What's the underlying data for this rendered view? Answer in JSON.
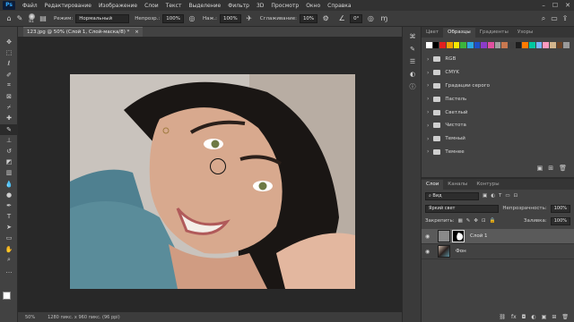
{
  "app": {
    "logo": "Ps"
  },
  "menubar": {
    "items": [
      "Файл",
      "Редактирование",
      "Изображение",
      "Слои",
      "Текст",
      "Выделение",
      "Фильтр",
      "3D",
      "Просмотр",
      "Окно",
      "Справка"
    ],
    "window_controls": [
      "minimize-icon",
      "maximize-icon",
      "close-icon"
    ]
  },
  "options": {
    "brush_size": "81",
    "mode_label": "Режим:",
    "mode_value": "Нормальный",
    "opacity_label": "Непрозр.:",
    "opacity_value": "100%",
    "flow_label": "Наж.:",
    "flow_value": "100%",
    "smoothing_label": "Сглаживание:",
    "smoothing_value": "10%",
    "angle_value": "0°"
  },
  "document": {
    "tab_title": "123.jpg @ 50% (Слой 1, Слой-маска/8) *"
  },
  "status": {
    "zoom": "50%",
    "doc_info": "1280 пикс. x 960 пикс. (96 ppi)"
  },
  "tools": [
    "move-tool",
    "marquee-tool",
    "lasso-tool",
    "quick-select-tool",
    "crop-tool",
    "frame-tool",
    "eyedropper-tool",
    "healing-tool",
    "brush-tool",
    "stamp-tool",
    "history-brush-tool",
    "eraser-tool",
    "gradient-tool",
    "blur-tool",
    "dodge-tool",
    "pen-tool",
    "type-tool",
    "path-select-tool",
    "rectangle-tool",
    "hand-tool",
    "zoom-tool",
    "more-tools"
  ],
  "swatches_panel": {
    "tabs": [
      "Цвет",
      "Образцы",
      "Градиенты",
      "Узоры"
    ],
    "active_tab": 1,
    "recent_colors": [
      "#ffffff",
      "#000000",
      "#e02020",
      "#f0a000",
      "#f5e600",
      "#3cb43c",
      "#2aa8e0",
      "#1e50c8",
      "#8c3cc8",
      "#e050a0",
      "#a0a0a0",
      "#c87850",
      "#404040",
      "#1e1e1e",
      "#ff7a00",
      "#00c8a0",
      "#7ab4ff",
      "#ff9ac0",
      "#d2b48c",
      "#6b4226",
      "#9a9a9a"
    ],
    "groups": [
      "RGB",
      "CMYK",
      "Градации серого",
      "Пастель",
      "Светлый",
      "Чистота",
      "Темный",
      "Темнее"
    ]
  },
  "layers_panel": {
    "tabs": [
      "Слои",
      "Каналы",
      "Контуры"
    ],
    "active_tab": 0,
    "filter_label": "Вид",
    "blend_mode": "Яркий свет",
    "opacity_label": "Непрозрачность:",
    "opacity_value": "100%",
    "lock_label": "Закрепить:",
    "fill_label": "Заливка:",
    "fill_value": "100%",
    "layers": [
      {
        "name": "Слой 1",
        "selected": true,
        "has_mask": true
      },
      {
        "name": "Фон",
        "selected": false,
        "has_mask": false
      }
    ]
  },
  "colors": {
    "accent": "#31a8ff",
    "fg_color": "#ffffff",
    "bg_color": "#000000"
  }
}
